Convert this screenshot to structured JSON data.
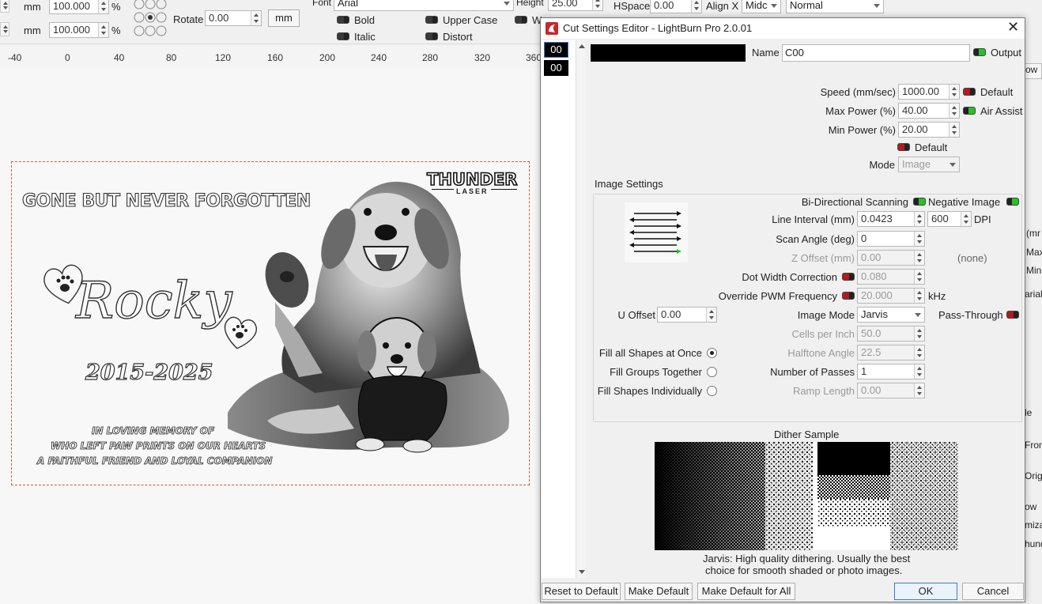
{
  "toolbar": {
    "mm1": "mm",
    "w": "100.000",
    "pct1": "%",
    "mm2": "mm",
    "h": "100.000",
    "pct2": "%",
    "rotate_label": "Rotate",
    "rotate": "0.00",
    "mm_btn": "mm",
    "font_label": "Font",
    "font": "Arial",
    "height_label": "Height",
    "height": "25.00",
    "hspace_label": "HSpace",
    "hspace": "0.00",
    "alignx_label": "Align X",
    "alignx": "Midc",
    "mode": "Normal",
    "bold": "Bold",
    "italic": "Italic",
    "upper": "Upper Case",
    "distort": "Distort",
    "w_short": "W"
  },
  "ruler": [
    "-40",
    "0",
    "40",
    "80",
    "120",
    "160",
    "200",
    "240",
    "280",
    "320",
    "360"
  ],
  "design": {
    "brand1": "THUNDER",
    "brand2": "LASER",
    "headline": "GONE BUT NEVER FORGOTTEN",
    "name": "Rocky",
    "years": "2015-2025",
    "line1": "IN LOVING MEMORY OF",
    "line2": "WHO LEFT PAW PRINTS ON OUR HEARTS",
    "line3": "A FAITHFUL FRIEND AND LOYAL COMPANION"
  },
  "dialog": {
    "title": "Cut Settings Editor - LightBurn Pro 2.0.01",
    "layers": [
      "00",
      "00"
    ],
    "name_label": "Name",
    "name": "C00",
    "output": "Output",
    "speed_label": "Speed (mm/sec)",
    "speed": "1000.00",
    "default1": "Default",
    "maxp_label": "Max Power (%)",
    "maxp": "40.00",
    "air": "Air Assist",
    "minp_label": "Min Power (%)",
    "minp": "20.00",
    "default2": "Default",
    "mode_label": "Mode",
    "mode": "Image",
    "img_settings": "Image Settings",
    "bidir": "Bi-Directional Scanning",
    "negative": "Negative Image",
    "line_int_label": "Line Interval (mm)",
    "line_int": "0.0423",
    "dpi": "600",
    "dpi_label": "DPI",
    "scan_label": "Scan Angle (deg)",
    "scan": "0",
    "zoff_label": "Z Offset (mm)",
    "zoff": "0.00",
    "none": "(none)",
    "dot_label": "Dot Width Correction",
    "dot": "0.080",
    "pwm_label": "Override PWM Frequency",
    "pwm": "20.000",
    "khz": "kHz",
    "uoff_label": "U Offset",
    "uoff": "0.00",
    "imode_label": "Image Mode",
    "imode": "Jarvis",
    "pass": "Pass-Through",
    "cells_label": "Cells per Inch",
    "cells": "50.0",
    "half_label": "Halftone Angle",
    "half": "22.5",
    "passes_label": "Number of Passes",
    "passes": "1",
    "ramp_label": "Ramp Length",
    "ramp": "0.00",
    "fill_all": "Fill all Shapes at Once",
    "fill_groups": "Fill Groups Together",
    "fill_ind": "Fill Shapes Individually",
    "dither": "Dither Sample",
    "desc1": "Jarvis: High quality dithering. Usually the best",
    "desc2": "choice for smooth shaded or photo images.",
    "reset": "Reset to Default",
    "make_def": "Make Default",
    "make_all": "Make Default for All",
    "ok": "OK",
    "cancel": "Cancel"
  },
  "right_edge": [
    "ow",
    "(mr",
    "Max",
    "Min",
    "arial",
    "le",
    "Fron",
    "Origi",
    "ow",
    "miza",
    "hund"
  ],
  "colors": {
    "accent": "#3a7bd5",
    "output_on": "#27c227",
    "off": "#b31b1b",
    "border_dash": "#d0622e"
  }
}
